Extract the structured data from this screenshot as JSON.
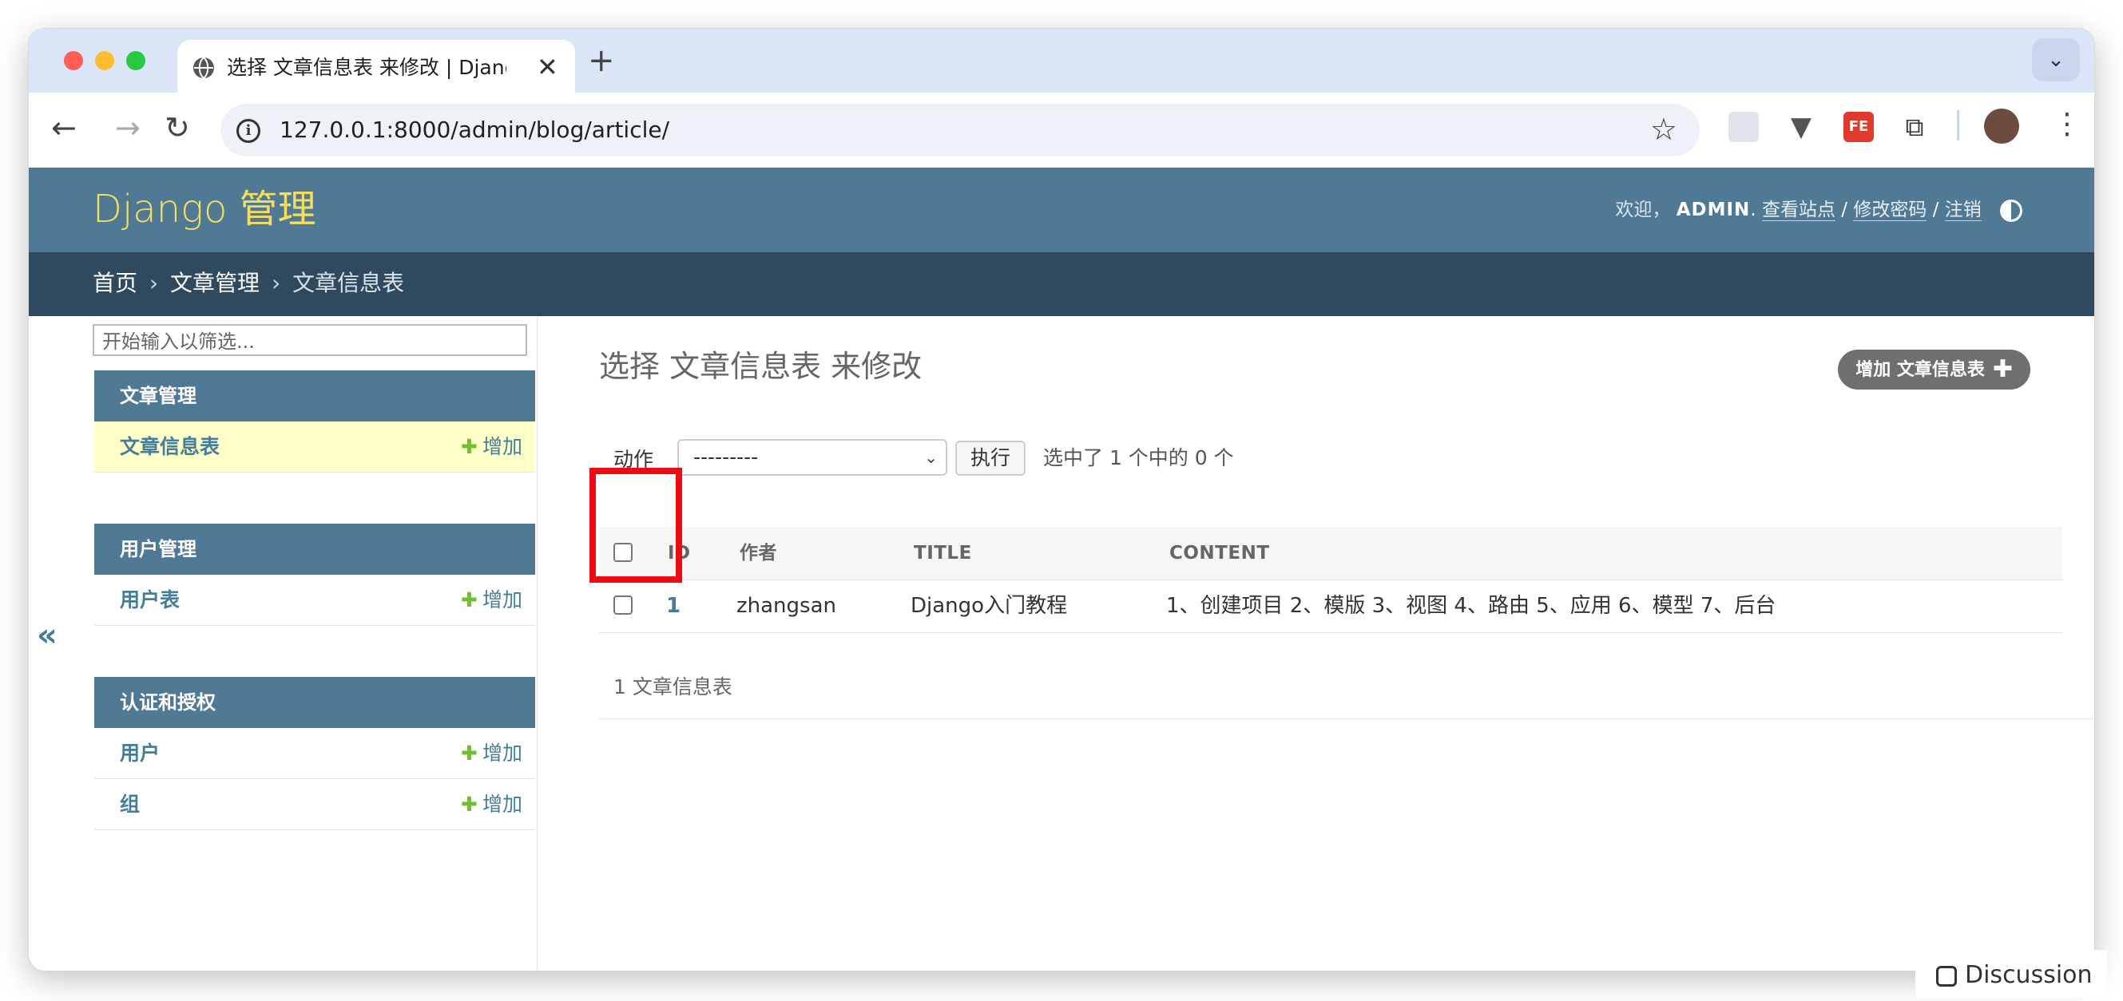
{
  "browser": {
    "tab_title": "选择 文章信息表 来修改 | Django",
    "url": "127.0.0.1:8000/admin/blog/article/",
    "new_tab_label": "+",
    "tab_close_label": "✕"
  },
  "header": {
    "branding": "Django 管理",
    "welcome": "欢迎，",
    "username": "ADMIN",
    "view_site": "查看站点",
    "change_password": "修改密码",
    "logout": "注销",
    "separator": "/"
  },
  "breadcrumbs": {
    "home": "首页",
    "app": "文章管理",
    "current": "文章信息表",
    "sep": "›"
  },
  "sidebar": {
    "filter_placeholder": "开始输入以筛选...",
    "add_label": "增加",
    "modules": [
      {
        "title": "文章管理",
        "models": [
          {
            "name": "文章信息表",
            "selected": true
          }
        ]
      },
      {
        "title": "用户管理",
        "models": [
          {
            "name": "用户表",
            "selected": false
          }
        ]
      },
      {
        "title": "认证和授权",
        "models": [
          {
            "name": "用户",
            "selected": false
          },
          {
            "name": "组",
            "selected": false
          }
        ]
      }
    ],
    "collapse_label": "«"
  },
  "main": {
    "title": "选择 文章信息表 来修改",
    "add_button": "增加 文章信息表",
    "actions": {
      "label": "动作",
      "selected_option": "---------",
      "go_button": "执行",
      "counter": "选中了 1 个中的 0 个"
    },
    "columns": [
      "ID",
      "作者",
      "TITLE",
      "CONTENT"
    ],
    "rows": [
      {
        "id": "1",
        "author": "zhangsan",
        "title": "Django入门教程",
        "content": "1、创建项目 2、模版 3、视图 4、路由 5、应用 6、模型 7、后台"
      }
    ],
    "paginator": "1 文章信息表"
  },
  "overlay": {
    "discussion": "Discussion"
  },
  "colors": {
    "header_bg": "#507995",
    "breadcrumb_bg": "#2f4a5f",
    "brand_yellow": "#f5dd5d",
    "link_blue": "#447e9b",
    "selected_row_bg": "#ffffc8",
    "highlight_red": "#ee0a14"
  }
}
